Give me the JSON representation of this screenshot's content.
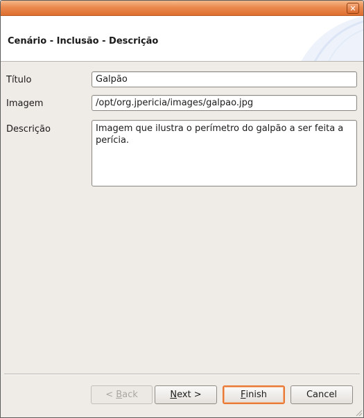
{
  "window": {
    "close_glyph": "✕"
  },
  "header": {
    "title": "Cenário - Inclusão - Descrição"
  },
  "form": {
    "titulo": {
      "label": "Título",
      "value": "Galpão"
    },
    "imagem": {
      "label": "Imagem",
      "value": "/opt/org.jpericia/images/galpao.jpg"
    },
    "descricao": {
      "label": "Descrição",
      "value": "Imagem que ilustra o perímetro do galpão a ser feita a perícia."
    }
  },
  "buttons": {
    "back": {
      "prefix": "< ",
      "mnemonic": "B",
      "rest": "ack",
      "enabled": false
    },
    "next": {
      "mnemonic": "N",
      "rest": "ext >"
    },
    "finish": {
      "mnemonic": "F",
      "rest": "inish"
    },
    "cancel": {
      "label": "Cancel"
    }
  },
  "colors": {
    "titlebar": "#de6f30",
    "default_button_border": "#e97a35",
    "window_bg": "#efebe7"
  }
}
